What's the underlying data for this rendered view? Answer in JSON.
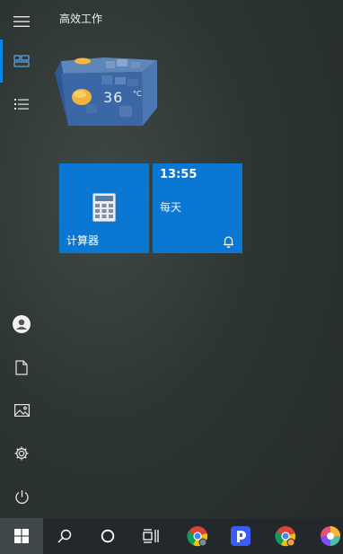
{
  "start_menu": {
    "group_title": "高效工作",
    "rail": {
      "items": [
        {
          "name": "hamburger-icon"
        },
        {
          "name": "tiles-icon",
          "active": true
        },
        {
          "name": "all-apps-list-icon"
        },
        {
          "name": "user-icon"
        },
        {
          "name": "documents-icon"
        },
        {
          "name": "pictures-icon"
        },
        {
          "name": "settings-icon"
        },
        {
          "name": "power-icon"
        }
      ]
    },
    "tiles": {
      "weather": {
        "temperature": "36",
        "unit": "°C"
      },
      "calculator": {
        "label": "计算器"
      },
      "clock": {
        "time": "13:55",
        "recurrence": "每天"
      }
    }
  },
  "taskbar": {
    "items": [
      {
        "name": "windows-start-icon"
      },
      {
        "name": "search-icon"
      },
      {
        "name": "cortana-icon"
      },
      {
        "name": "task-view-icon"
      },
      {
        "name": "chrome-icon"
      },
      {
        "name": "app-icon-blue"
      },
      {
        "name": "chrome-icon-2"
      },
      {
        "name": "colorful-app-icon"
      }
    ]
  },
  "colors": {
    "accent": "#0a78d2",
    "active_indicator": "#0a84e6",
    "taskbar": "#22282b",
    "background": "#2c3533"
  }
}
